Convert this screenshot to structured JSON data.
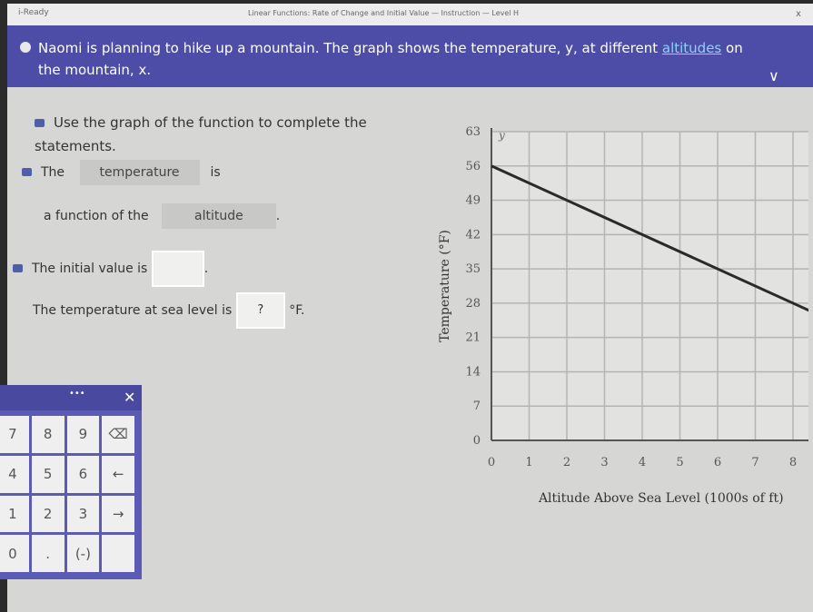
{
  "titlebar": {
    "app": "i-Ready",
    "title": "Linear Functions: Rate of Change and Initial Value — Instruction — Level H",
    "close": "x"
  },
  "banner": {
    "text_before": "Naomi is planning to hike up a mountain. The graph shows the temperature, y, at different ",
    "link": "altitudes",
    "text_after": " on the mountain, x.",
    "chevron": "∨"
  },
  "prompt": "Use the graph of the function to complete the statements.",
  "s1": {
    "pre": "The",
    "dropdown": "temperature",
    "post": "is"
  },
  "s2": {
    "pre": "a function of the",
    "dropdown": "altitude",
    "post": "."
  },
  "s3": {
    "pre": "The initial value is",
    "value": "",
    "post": "."
  },
  "s4": {
    "pre": "The temperature at sea level is",
    "value": "?",
    "post": "°F."
  },
  "keypad": {
    "handle": "•••",
    "close": "✕",
    "keys": [
      "7",
      "8",
      "9",
      "⌫",
      "4",
      "5",
      "6",
      "←",
      "1",
      "2",
      "3",
      "→",
      "0",
      ".",
      "(-)",
      ""
    ]
  },
  "chart_data": {
    "type": "line",
    "xlabel": "Altitude Above Sea Level (1000s of ft)",
    "ylabel": "Temperature (°F)",
    "y_axis_var": "y",
    "xlim": [
      0,
      9
    ],
    "ylim": [
      0,
      63
    ],
    "xticks": [
      "0",
      "1",
      "2",
      "3",
      "4",
      "5",
      "6",
      "7",
      "8"
    ],
    "yticks": [
      "0",
      "7",
      "14",
      "21",
      "28",
      "35",
      "42",
      "49",
      "56",
      "63"
    ],
    "grid": true,
    "series": [
      {
        "x": [
          0,
          9
        ],
        "y": [
          56,
          24.5
        ]
      }
    ]
  }
}
